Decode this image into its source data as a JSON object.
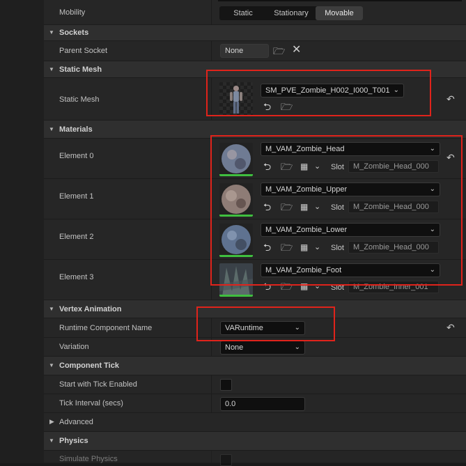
{
  "mobility": {
    "label": "Mobility",
    "options": [
      "Static",
      "Stationary",
      "Movable"
    ]
  },
  "sockets": {
    "title": "Sockets",
    "parent_socket": {
      "label": "Parent Socket",
      "value": "None"
    }
  },
  "static_mesh": {
    "title": "Static Mesh",
    "row": {
      "label": "Static Mesh",
      "value": "SM_PVE_Zombie_H002_I000_T001"
    }
  },
  "materials": {
    "title": "Materials",
    "slot_label": "Slot",
    "elements": [
      {
        "label": "Element 0",
        "material": "M_VAM_Zombie_Head",
        "slot": "M_Zombie_Head_000"
      },
      {
        "label": "Element 1",
        "material": "M_VAM_Zombie_Upper",
        "slot": "M_Zombie_Head_000"
      },
      {
        "label": "Element 2",
        "material": "M_VAM_Zombie_Lower",
        "slot": "M_Zombie_Head_000"
      },
      {
        "label": "Element 3",
        "material": "M_VAM_Zombie_Foot",
        "slot": "M_Zombie_Inner_001"
      }
    ]
  },
  "vertex_animation": {
    "title": "Vertex Animation",
    "runtime_component": {
      "label": "Runtime Component Name",
      "value": "VARuntime"
    },
    "variation": {
      "label": "Variation",
      "value": "None"
    }
  },
  "component_tick": {
    "title": "Component Tick",
    "start_with_tick": {
      "label": "Start with Tick Enabled"
    },
    "tick_interval": {
      "label": "Tick Interval (secs)",
      "value": "0.0"
    },
    "advanced": "Advanced"
  },
  "physics": {
    "title": "Physics",
    "simulate": {
      "label": "Simulate Physics"
    }
  },
  "colors": {
    "accent_red": "#e0231b",
    "green_bar": "#3fbf3f"
  }
}
